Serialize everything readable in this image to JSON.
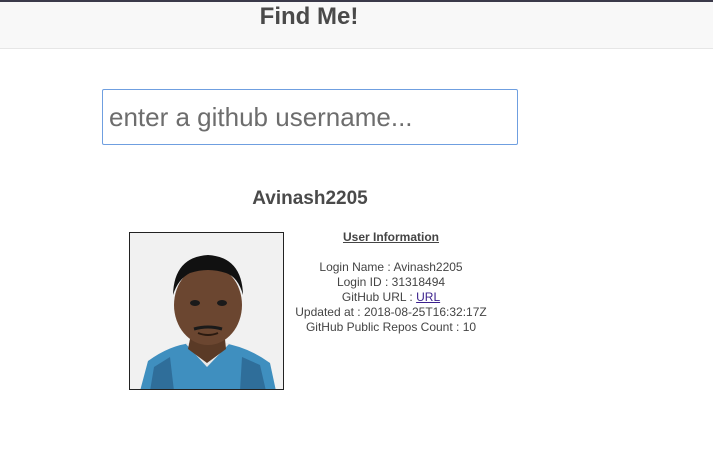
{
  "header": {
    "title": "Find Me!"
  },
  "search": {
    "placeholder": "enter a github username..."
  },
  "profile": {
    "username": "Avinash2205",
    "avatar_icon": "user-photo",
    "info": {
      "heading": "User Information",
      "login_name_label": "Login Name : ",
      "login_name": "Avinash2205",
      "login_id_label": "Login ID : ",
      "login_id": "31318494",
      "github_url_label": "GitHub URL : ",
      "github_url_link": "URL ",
      "updated_label": "Updated at : ",
      "updated_at": "2018-08-25T16:32:17Z",
      "repos_label": "GitHub Public Repos Count : ",
      "repos_count": "10"
    }
  },
  "colors": {
    "accent_border": "#6f9fe0",
    "link": "#3a1f8c",
    "header_bg": "#f8f8f8"
  }
}
